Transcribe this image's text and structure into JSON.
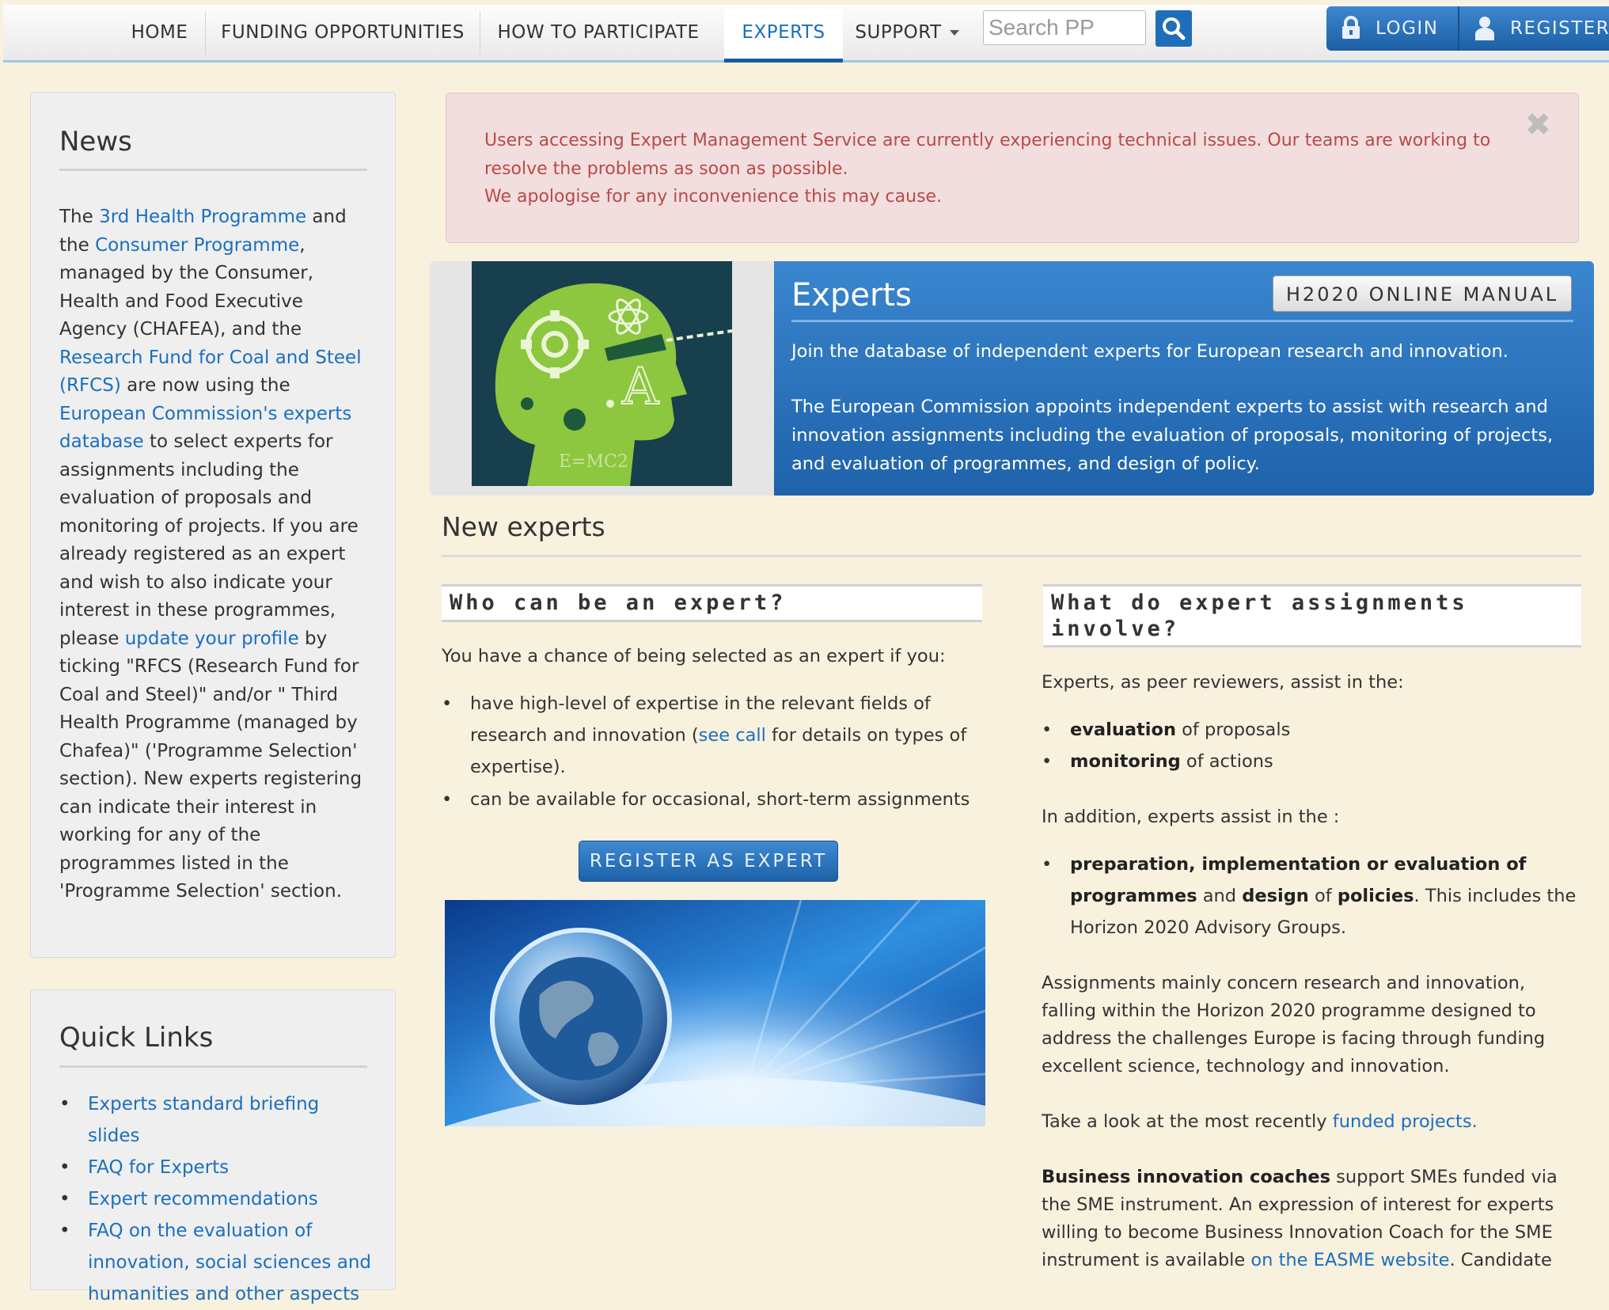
{
  "nav": {
    "items": [
      "HOME",
      "FUNDING OPPORTUNITIES",
      "HOW TO PARTICIPATE",
      "EXPERTS",
      "SUPPORT"
    ],
    "active": "EXPERTS",
    "search_placeholder": "Search PP",
    "login": "LOGIN",
    "register": "REGISTER"
  },
  "news": {
    "title": "News",
    "segments": [
      {
        "t": "The "
      },
      {
        "t": "3rd Health Programme",
        "link": true
      },
      {
        "t": " and the "
      },
      {
        "t": "Consumer Programme",
        "link": true
      },
      {
        "t": ", managed by the Consumer, Health and Food Executive Agency (CHAFEA), and the "
      },
      {
        "t": "Research Fund for Coal and Steel (RFCS)",
        "link": true
      },
      {
        "t": " are now using the "
      },
      {
        "t": "European Commission's experts database",
        "link": true
      },
      {
        "t": " to select experts for assignments including the evaluation of proposals and monitoring of projects. If you are already registered as an expert and wish to also indicate your interest in these programmes, please "
      },
      {
        "t": "update your profile",
        "link": true
      },
      {
        "t": " by ticking \"RFCS (Research Fund for Coal and Steel)\" and/or \" Third Health Programme (managed by Chafea)\" ('Programme Selection' section). New experts registering can indicate their interest in working for any of the programmes listed in the 'Programme Selection' section."
      }
    ]
  },
  "quick_links": {
    "title": "Quick Links",
    "items": [
      "Experts standard briefing slides",
      "FAQ for Experts",
      "Expert recommendations",
      "FAQ on the evaluation of innovation, social sciences and humanities and other aspects"
    ]
  },
  "alert": {
    "line1": "Users accessing Expert Management Service are currently experiencing technical issues. Our teams are working to resolve the problems as soon as possible.",
    "line2": "We apologise for any inconvenience this may cause."
  },
  "hero": {
    "title": "Experts",
    "manual_button": "H2020 ONLINE MANUAL",
    "p1": "Join the database of independent experts for European research and innovation.",
    "p2": "The European Commission appoints independent experts to assist with research and innovation assignments including the evaluation of proposals, monitoring of projects, and evaluation of programmes, and design of policy."
  },
  "new_experts": {
    "title": "New experts",
    "who": {
      "heading": "Who can be an expert?",
      "intro": "You have a chance of being selected as an expert if you:",
      "b1_pre": "have high-level of expertise in the relevant fields of research and innovation (",
      "b1_link": "see call",
      "b1_post": " for details on types of expertise).",
      "b2": "can be available for occasional, short-term assignments",
      "register_button": "REGISTER AS EXPERT"
    },
    "what": {
      "heading": "What do expert assignments involve?",
      "intro": "Experts, as peer reviewers, assist in the:",
      "b1_bold": "evaluation",
      "b1_rest": " of proposals",
      "b2_bold": "monitoring",
      "b2_rest": " of actions",
      "addition": "In addition, experts assist in the :",
      "b3_bold1": "preparation, implementation or evaluation of programmes",
      "b3_mid": " and ",
      "b3_bold2": "design",
      "b3_mid2": " of ",
      "b3_bold3": "policies",
      "b3_rest": ". This includes the Horizon 2020 Advisory Groups.",
      "assign": "Assignments mainly concern research and innovation, falling within the Horizon 2020 programme designed to address the challenges Europe is facing through funding excellent science, technology and innovation.",
      "look_pre": "Take a look at the most recently ",
      "look_link": "funded projects.",
      "biz_bold": "Business innovation coaches",
      "biz_rest": " support SMEs funded via the SME instrument. An expression of interest for experts willing to become Business Innovation Coach for the SME instrument is available ",
      "biz_link": "on the EASME website",
      "biz_tail": ". Candidate"
    }
  },
  "hero_image_text": "E=MC2",
  "hero_image_letter": "A",
  "colors": {
    "accent": "#1a6fc0",
    "alert_text": "#b94a48",
    "hero_blue": "#2a72bd"
  }
}
